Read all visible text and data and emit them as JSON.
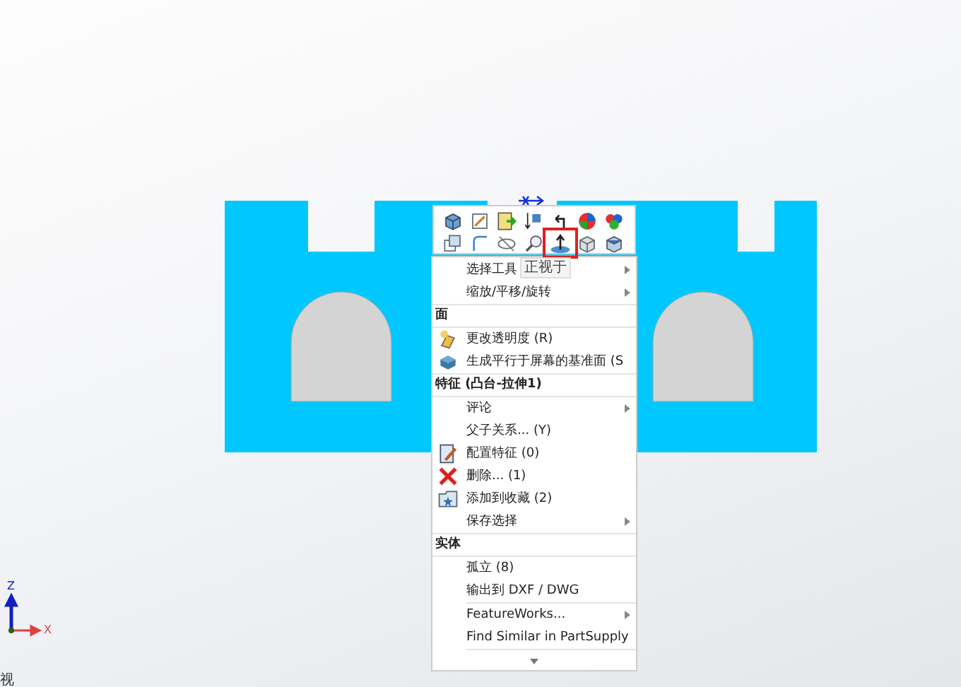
{
  "toolbar": {
    "tooltip": "正视于"
  },
  "menu": [
    {
      "kind": "item",
      "label": "选择工具",
      "submenu": true
    },
    {
      "kind": "item",
      "label": "缩放/平移/旋转",
      "submenu": true
    },
    {
      "kind": "header",
      "label": "面"
    },
    {
      "kind": "item",
      "label": "更改透明度 (R)",
      "submenu": false
    },
    {
      "kind": "item",
      "label": "生成平行于屏幕的基准面 (S",
      "submenu": false
    },
    {
      "kind": "header",
      "label": "特征 (凸台-拉伸1)"
    },
    {
      "kind": "item",
      "label": "评论",
      "submenu": true
    },
    {
      "kind": "item",
      "label": "父子关系... (Y)",
      "submenu": false
    },
    {
      "kind": "item",
      "label": "配置特征 (0)",
      "submenu": false
    },
    {
      "kind": "item",
      "label": "删除... (1)",
      "submenu": false
    },
    {
      "kind": "item",
      "label": "添加到收藏 (2)",
      "submenu": false
    },
    {
      "kind": "item",
      "label": "保存选择",
      "submenu": true
    },
    {
      "kind": "header",
      "label": "实体"
    },
    {
      "kind": "item",
      "label": "孤立 (8)",
      "submenu": false
    },
    {
      "kind": "item",
      "label": "输出到 DXF / DWG",
      "submenu": false
    },
    {
      "kind": "separator"
    },
    {
      "kind": "item",
      "label": "FeatureWorks...",
      "submenu": true
    },
    {
      "kind": "item",
      "label": "Find Similar in PartSupply",
      "submenu": false
    },
    {
      "kind": "separator"
    }
  ],
  "status_bar": {
    "text": "视"
  },
  "triad": {
    "z": "Z",
    "x": "X"
  }
}
